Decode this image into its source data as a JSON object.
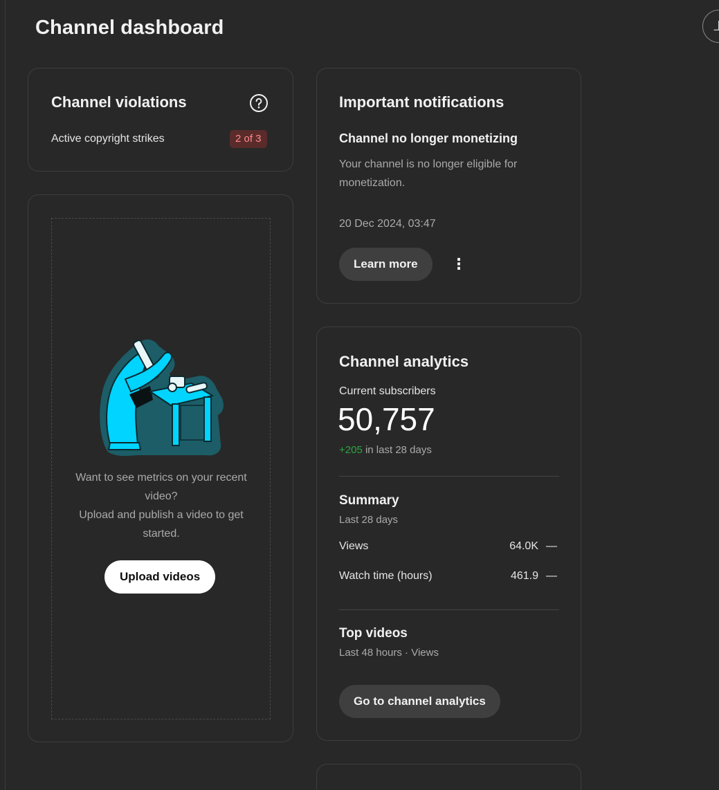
{
  "page": {
    "title": "Channel dashboard"
  },
  "violations": {
    "title": "Channel violations",
    "strikes_label": "Active copyright strikes",
    "strikes_value": "2 of 3"
  },
  "upload": {
    "message_line1": "Want to see metrics on your recent video?",
    "message_line2": "Upload and publish a video to get started.",
    "button_label": "Upload videos"
  },
  "notifications": {
    "title": "Important notifications",
    "heading": "Channel no longer monetizing",
    "body": "Your channel is no longer eligible for monetization.",
    "date": "20 Dec 2024, 03:47",
    "learn_more_label": "Learn more"
  },
  "analytics": {
    "title": "Channel analytics",
    "subscribers_label": "Current subscribers",
    "subscribers_count": "50,757",
    "subscribers_delta": "+205",
    "subscribers_delta_suffix": "in last 28 days",
    "summary_title": "Summary",
    "summary_period": "Last 28 days",
    "metrics": [
      {
        "label": "Views",
        "value": "64.0K",
        "trend": "—"
      },
      {
        "label": "Watch time (hours)",
        "value": "461.9",
        "trend": "—"
      }
    ],
    "top_videos_title": "Top videos",
    "top_videos_sub": "Last 48 hours · Views",
    "button_label": "Go to channel analytics"
  },
  "icons": {
    "help": "help-circle-icon",
    "more": "more-vert-icon"
  },
  "colors": {
    "background": "#282828",
    "card_border": "#3e3e3e",
    "positive": "#2ba640",
    "strike_badge_bg": "#5a2b2b",
    "strike_badge_text": "#ff8a8a",
    "illustration_cyan": "#00d4ff",
    "illustration_teal": "#1c5d67"
  }
}
